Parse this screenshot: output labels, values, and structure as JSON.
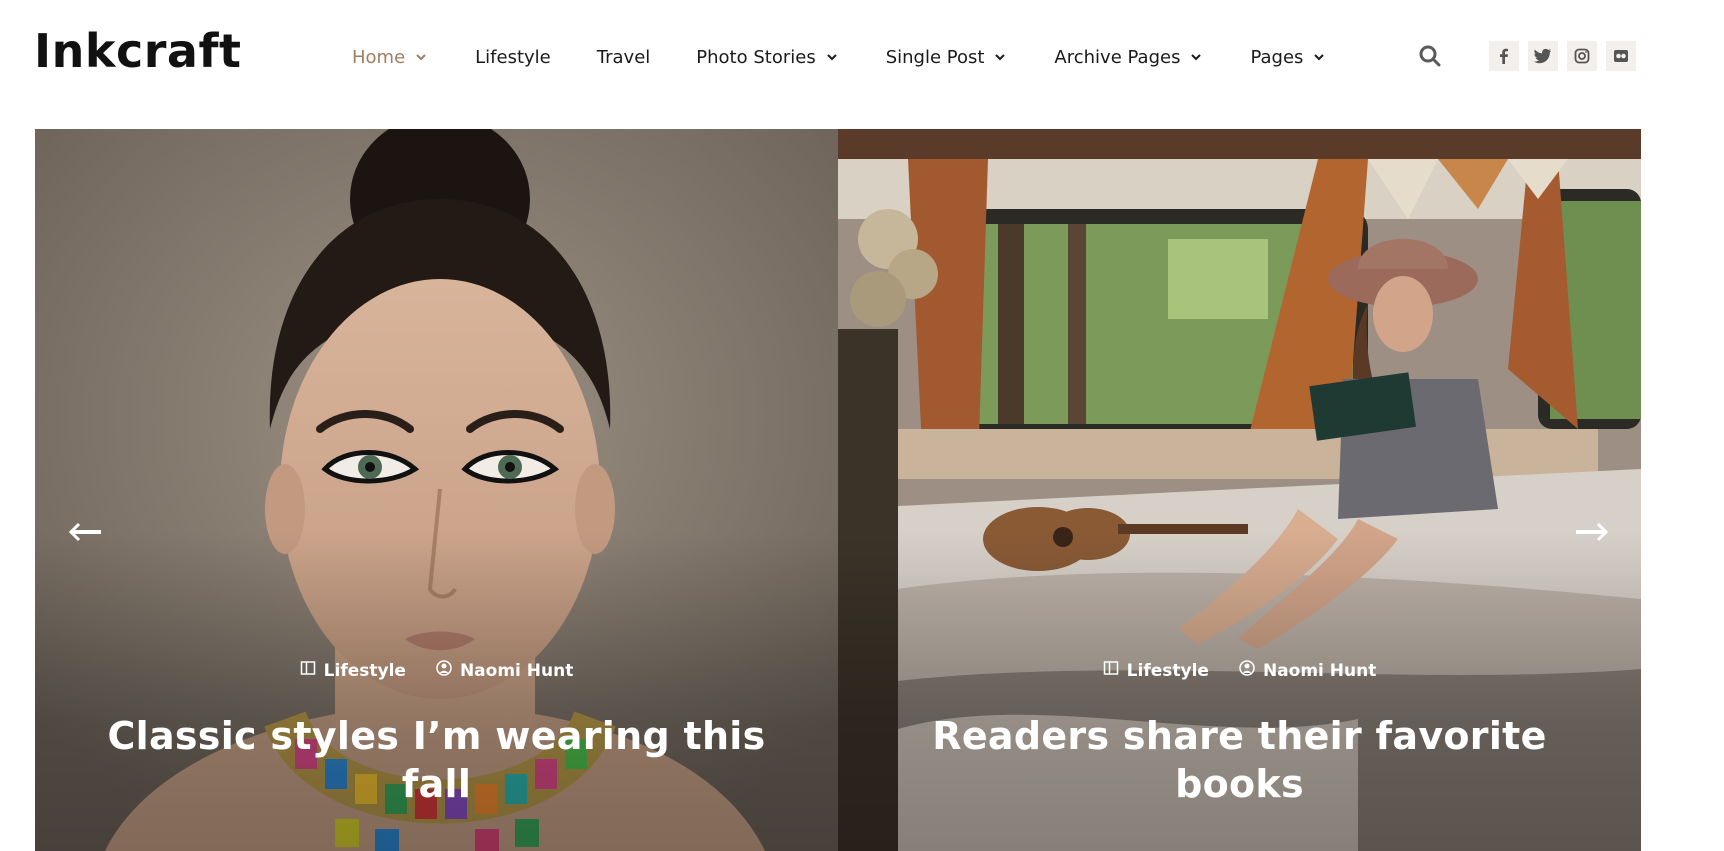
{
  "site": {
    "logo": "Inkcraft"
  },
  "nav": {
    "items": [
      {
        "label": "Home",
        "active": true,
        "dropdown": true
      },
      {
        "label": "Lifestyle",
        "active": false,
        "dropdown": false
      },
      {
        "label": "Travel",
        "active": false,
        "dropdown": false
      },
      {
        "label": "Photo Stories",
        "active": false,
        "dropdown": true
      },
      {
        "label": "Single Post",
        "active": false,
        "dropdown": true
      },
      {
        "label": "Archive Pages",
        "active": false,
        "dropdown": true
      },
      {
        "label": "Pages",
        "active": false,
        "dropdown": true
      }
    ]
  },
  "header_icons": {
    "search": "search-icon",
    "socials": [
      "facebook-icon",
      "twitter-icon",
      "instagram-icon",
      "flickr-icon"
    ]
  },
  "colors": {
    "accent": "#a07e62",
    "text": "#1a1a1a",
    "social_bg": "#f3efec"
  },
  "slider": {
    "slides": [
      {
        "category": "Lifestyle",
        "author": "Naomi Hunt",
        "title": "Classic styles I’m wearing this fall",
        "image": "portrait of woman with bold eyeliner and colorful beaded necklace"
      },
      {
        "category": "Lifestyle",
        "author": "Naomi Hunt",
        "title": "Readers share their favorite books",
        "image": "woman in hat reading a book inside a camper van"
      }
    ],
    "prev_icon": "arrow-left-icon",
    "next_icon": "arrow-right-icon"
  }
}
